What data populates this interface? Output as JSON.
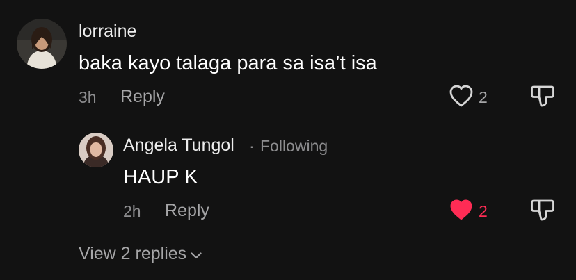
{
  "comments": [
    {
      "username": "lorraine",
      "text": "baka kayo talaga para sa isa’t isa",
      "time": "3h",
      "reply_label": "Reply",
      "likes": "2",
      "liked": false
    }
  ],
  "reply": {
    "username": "Angela Tungol",
    "separator": "·",
    "follow_status": "Following",
    "text": "HAUP K",
    "time": "2h",
    "reply_label": "Reply",
    "likes": "2",
    "liked": true
  },
  "view_replies_label": "View 2 replies",
  "icons": {
    "like": "heart-outline-icon",
    "liked": "heart-filled-icon",
    "dislike": "thumbs-down-icon",
    "expand": "chevron-down-icon"
  },
  "colors": {
    "background": "#121212",
    "liked": "#fe2c55",
    "muted": "#8d8d8f"
  }
}
